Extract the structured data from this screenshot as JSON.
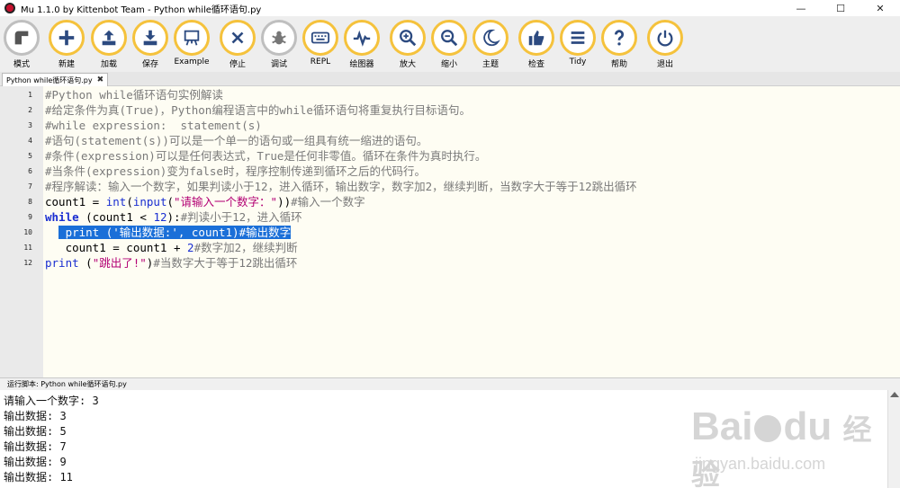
{
  "window": {
    "title": "Mu 1.1.0 by Kittenbot Team - Python while循环语句.py",
    "minimize": "—",
    "maximize": "☐",
    "close": "✕"
  },
  "toolbar": {
    "mode": "模式",
    "new": "新建",
    "load": "加载",
    "save": "保存",
    "example": "Example",
    "stop": "停止",
    "debug": "调试",
    "repl": "REPL",
    "plotter": "绘图器",
    "zoom_in": "放大",
    "zoom_out": "缩小",
    "theme": "主题",
    "check": "检查",
    "tidy": "Tidy",
    "help": "帮助",
    "quit": "退出"
  },
  "tab": {
    "label": "Python while循环语句.py",
    "close": "✖"
  },
  "editor": {
    "line_numbers": [
      "1",
      "2",
      "3",
      "4",
      "5",
      "6",
      "7",
      "8",
      "9",
      "10",
      "11",
      "12"
    ],
    "l1": "#Python while循环语句实例解读",
    "l2": "#给定条件为真(True)，Python编程语言中的while循环语句将重复执行目标语句。",
    "l3": "#while expression:  statement(s)",
    "l4": "#语句(statement(s))可以是一个单一的语句或一组具有统一缩进的语句。",
    "l5": "#条件(expression)可以是任何表达式，True是任何非零值。循环在条件为真时执行。",
    "l6": "#当条件(expression)变为false时，程序控制传递到循环之后的代码行。",
    "l7": "#程序解读：输入一个数字，如果判读小于12，进入循环，输出数字，数字加2，继续判断，当数字大于等于12跳出循环",
    "l8_a": "count1 = ",
    "l8_b": "int",
    "l8_c": "(",
    "l8_d": "input",
    "l8_e": "(",
    "l8_f": "\"请输入一个数字：\"",
    "l8_g": "))",
    "l8_h": "#输入一个数字",
    "l9_a": "while",
    "l9_b": " (count1 < ",
    "l9_c": "12",
    "l9_d": "):",
    "l9_e": "#判读小于12，进入循环",
    "l10_indent": "  ",
    "l10_sel": " print ('输出数据:', count1)#输出数字",
    "l11_a": "   count1 = count1 + ",
    "l11_b": "2",
    "l11_c": "#数字加2，继续判断",
    "l12_a": "print",
    "l12_b": " (",
    "l12_c": "\"跳出了!\"",
    "l12_d": ")",
    "l12_e": "#当数字大于等于12跳出循环"
  },
  "runner": {
    "header": "运行脚本: Python while循环语句.py",
    "lines": [
      "请输入一个数字: 3",
      "输出数据: 3",
      "输出数据: 5",
      "输出数据: 7",
      "输出数据: 9",
      "输出数据: 11"
    ]
  },
  "watermark": {
    "brand": "Bai",
    "brand2": "du",
    "cn": "经验",
    "url": "jingyan.baidu.com"
  }
}
